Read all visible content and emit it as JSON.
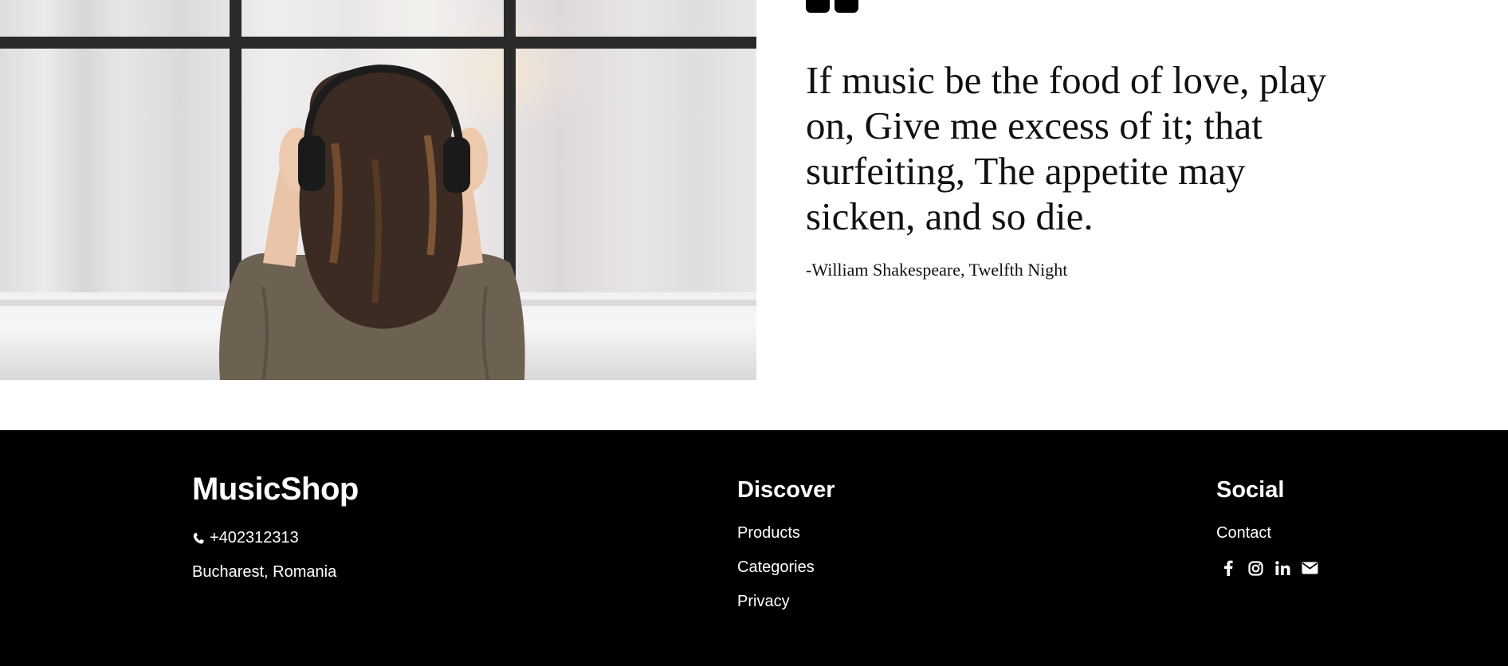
{
  "quote": {
    "text": "If music be the food of love, play on, Give me excess of it; that surfeiting, The appetite may sicken, and so die.",
    "author": "-William Shakespeare, Twelfth Night",
    "icon": "quote-icon"
  },
  "hero_image": {
    "subject": "woman-with-headphones-photo"
  },
  "footer": {
    "brand": "MusicShop",
    "phone": "+402312313",
    "phone_icon": "phone-icon",
    "address": "Bucharest, Romania",
    "discover": {
      "title": "Discover",
      "links": [
        "Products",
        "Categories",
        "Privacy"
      ]
    },
    "social": {
      "title": "Social",
      "links": [
        "Contact"
      ],
      "icons": [
        "facebook-icon",
        "instagram-icon",
        "linkedin-icon",
        "email-icon"
      ]
    }
  },
  "colors": {
    "footer_bg": "#000000",
    "footer_text": "#ffffff",
    "quote_text": "#111111"
  }
}
